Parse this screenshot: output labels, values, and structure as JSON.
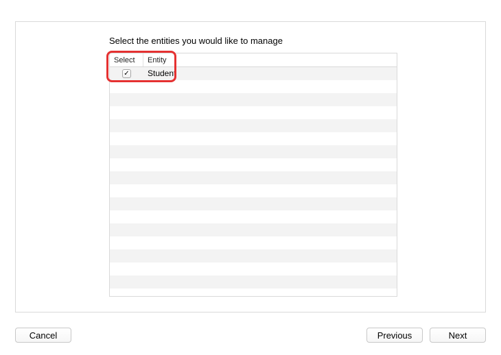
{
  "instruction": "Select the entities you would like to manage",
  "table": {
    "headers": {
      "select": "Select",
      "entity": "Entity"
    },
    "rows": [
      {
        "checked": true,
        "entity": "Student"
      }
    ],
    "empty_row_count": 17
  },
  "buttons": {
    "cancel": "Cancel",
    "previous": "Previous",
    "next": "Next"
  }
}
